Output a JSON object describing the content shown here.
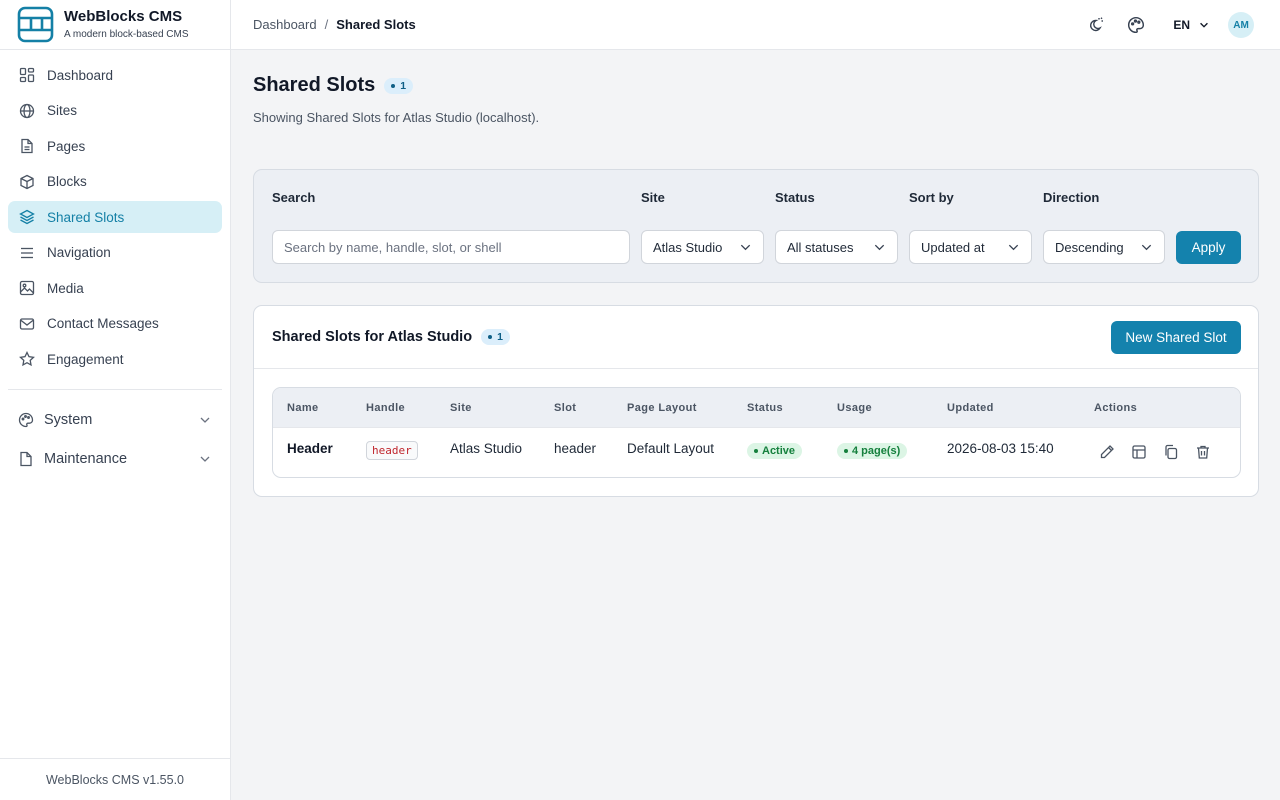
{
  "brand": {
    "title": "WebBlocks CMS",
    "subtitle": "A modern block-based CMS"
  },
  "sidebar": {
    "items": [
      {
        "label": "Dashboard",
        "icon": "dashboard-icon"
      },
      {
        "label": "Sites",
        "icon": "globe-icon"
      },
      {
        "label": "Pages",
        "icon": "document-icon"
      },
      {
        "label": "Blocks",
        "icon": "cube-icon"
      },
      {
        "label": "Shared Slots",
        "icon": "layers-icon",
        "active": true
      },
      {
        "label": "Navigation",
        "icon": "menu-icon"
      },
      {
        "label": "Media",
        "icon": "image-icon"
      },
      {
        "label": "Contact Messages",
        "icon": "mail-icon"
      },
      {
        "label": "Engagement",
        "icon": "star-icon"
      }
    ],
    "groups": [
      {
        "label": "System",
        "icon": "palette-icon"
      },
      {
        "label": "Maintenance",
        "icon": "file-icon"
      }
    ],
    "footer": "WebBlocks CMS v1.55.0"
  },
  "topbar": {
    "breadcrumb": {
      "parent": "Dashboard",
      "separator": "/",
      "current": "Shared Slots"
    },
    "language": "EN",
    "avatar": "AM"
  },
  "page": {
    "title": "Shared Slots",
    "count": "1",
    "subtitle": "Showing Shared Slots for Atlas Studio (localhost)."
  },
  "filters": {
    "search_label": "Search",
    "search_placeholder": "Search by name, handle, slot, or shell",
    "site_label": "Site",
    "site_value": "Atlas Studio",
    "status_label": "Status",
    "status_value": "All statuses",
    "sort_label": "Sort by",
    "sort_value": "Updated at",
    "direction_label": "Direction",
    "direction_value": "Descending",
    "apply_label": "Apply"
  },
  "list": {
    "title": "Shared Slots for Atlas Studio",
    "count": "1",
    "new_button": "New Shared Slot",
    "columns": [
      "Name",
      "Handle",
      "Site",
      "Slot",
      "Page Layout",
      "Status",
      "Usage",
      "Updated",
      "Actions"
    ],
    "rows": [
      {
        "name": "Header",
        "handle": "header",
        "site": "Atlas Studio",
        "slot": "header",
        "layout": "Default Layout",
        "status": "Active",
        "usage": "4 page(s)",
        "updated": "2026-08-03 15:40"
      }
    ]
  },
  "colors": {
    "accent": "#1482ad",
    "active_bg": "#d6eff6",
    "status_green": "#15803d"
  }
}
